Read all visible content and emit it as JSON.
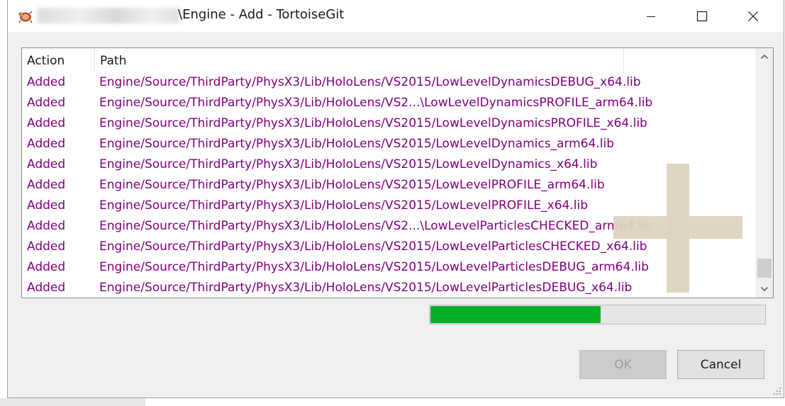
{
  "window": {
    "title": "\\Engine - Add - TortoiseGit",
    "icon": "tortoisegit-icon",
    "controls": {
      "minimize": "minimize-icon",
      "maximize": "maximize-icon",
      "close": "close-icon"
    }
  },
  "list": {
    "columns": [
      "Action",
      "Path"
    ],
    "rows": [
      {
        "action": "Added",
        "path": "Engine/Source/ThirdParty/PhysX3/Lib/HoloLens/VS2015/LowLevelDynamicsDEBUG_x64.lib"
      },
      {
        "action": "Added",
        "path": "Engine/Source/ThirdParty/PhysX3/Lib/HoloLens/VS2...\\LowLevelDynamicsPROFILE_arm64.lib"
      },
      {
        "action": "Added",
        "path": "Engine/Source/ThirdParty/PhysX3/Lib/HoloLens/VS2015/LowLevelDynamicsPROFILE_x64.lib"
      },
      {
        "action": "Added",
        "path": "Engine/Source/ThirdParty/PhysX3/Lib/HoloLens/VS2015/LowLevelDynamics_arm64.lib"
      },
      {
        "action": "Added",
        "path": "Engine/Source/ThirdParty/PhysX3/Lib/HoloLens/VS2015/LowLevelDynamics_x64.lib"
      },
      {
        "action": "Added",
        "path": "Engine/Source/ThirdParty/PhysX3/Lib/HoloLens/VS2015/LowLevelPROFILE_arm64.lib"
      },
      {
        "action": "Added",
        "path": "Engine/Source/ThirdParty/PhysX3/Lib/HoloLens/VS2015/LowLevelPROFILE_x64.lib"
      },
      {
        "action": "Added",
        "path": "Engine/Source/ThirdParty/PhysX3/Lib/HoloLens/VS2...\\LowLevelParticlesCHECKED_arm64.lib"
      },
      {
        "action": "Added",
        "path": "Engine/Source/ThirdParty/PhysX3/Lib/HoloLens/VS2015/LowLevelParticlesCHECKED_x64.lib"
      },
      {
        "action": "Added",
        "path": "Engine/Source/ThirdParty/PhysX3/Lib/HoloLens/VS2015/LowLevelParticlesDEBUG_arm64.lib"
      },
      {
        "action": "Added",
        "path": "Engine/Source/ThirdParty/PhysX3/Lib/HoloLens/VS2015/LowLevelParticlesDEBUG_x64.lib"
      }
    ],
    "scroll": {
      "up": "chevron-up-icon",
      "down": "chevron-down-icon"
    },
    "overlay": "plus-watermark-icon"
  },
  "progress": {
    "fraction": 0.51,
    "color": "#06b025"
  },
  "buttons": {
    "ok": "OK",
    "cancel": "Cancel"
  },
  "colors": {
    "added_text": "#800080"
  }
}
